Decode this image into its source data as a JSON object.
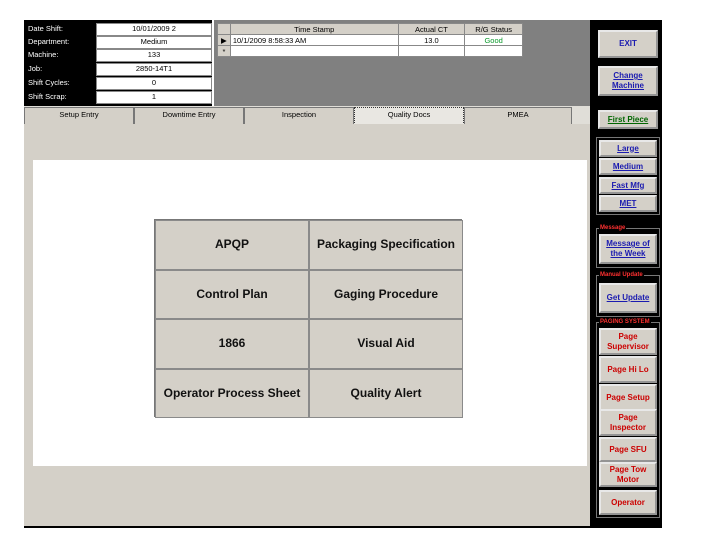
{
  "info": [
    {
      "label": "Date  Shift:",
      "value": "10/01/2009   2"
    },
    {
      "label": "Department:",
      "value": "Medium"
    },
    {
      "label": "Machine:",
      "value": "133"
    },
    {
      "label": "Job:",
      "value": "2850-14T1"
    },
    {
      "label": "Shift Cycles:",
      "value": "0"
    },
    {
      "label": "Shift Scrap:",
      "value": "1"
    }
  ],
  "grid": {
    "columns": [
      "Time Stamp",
      "Actual CT",
      "R/G Status"
    ],
    "rows": [
      {
        "marker": "▶",
        "time_stamp": "10/1/2009 8:58:33 AM",
        "actual_ct": "13.0",
        "status": "Good"
      },
      {
        "marker": "*",
        "time_stamp": "",
        "actual_ct": "",
        "status": ""
      }
    ]
  },
  "tabs": [
    "Setup Entry",
    "Downtime Entry",
    "Inspection",
    "Quality Docs",
    "PMEA"
  ],
  "active_tab": "Quality Docs",
  "docs": [
    [
      "APQP",
      "Packaging Specification"
    ],
    [
      "Control Plan",
      "Gaging Procedure"
    ],
    [
      "1866",
      "Visual Aid"
    ],
    [
      "Operator Process Sheet",
      "Quality Alert"
    ]
  ],
  "sidebar": {
    "exit": "EXIT",
    "change_machine": "Change Machine",
    "first_piece": "First Piece",
    "departments": [
      "Large",
      "Medium",
      "Fast Mfg",
      "MET"
    ],
    "message_header": "Message",
    "message_button": "Message of the Week",
    "manual_update_header": "Manual Update",
    "get_update": "Get Update",
    "paging_header": "PAGING SYSTEM",
    "paging": [
      "Page Supervisor",
      "Page Hi Lo",
      "Page Setup",
      "Page Inspector",
      "Page SFU",
      "Page Tow Motor",
      "Operator"
    ]
  },
  "colors": {
    "good": "#0a9a2a",
    "link": "#1b1bb0",
    "alert": "#cc0000",
    "panel": "#d4d0c8"
  }
}
